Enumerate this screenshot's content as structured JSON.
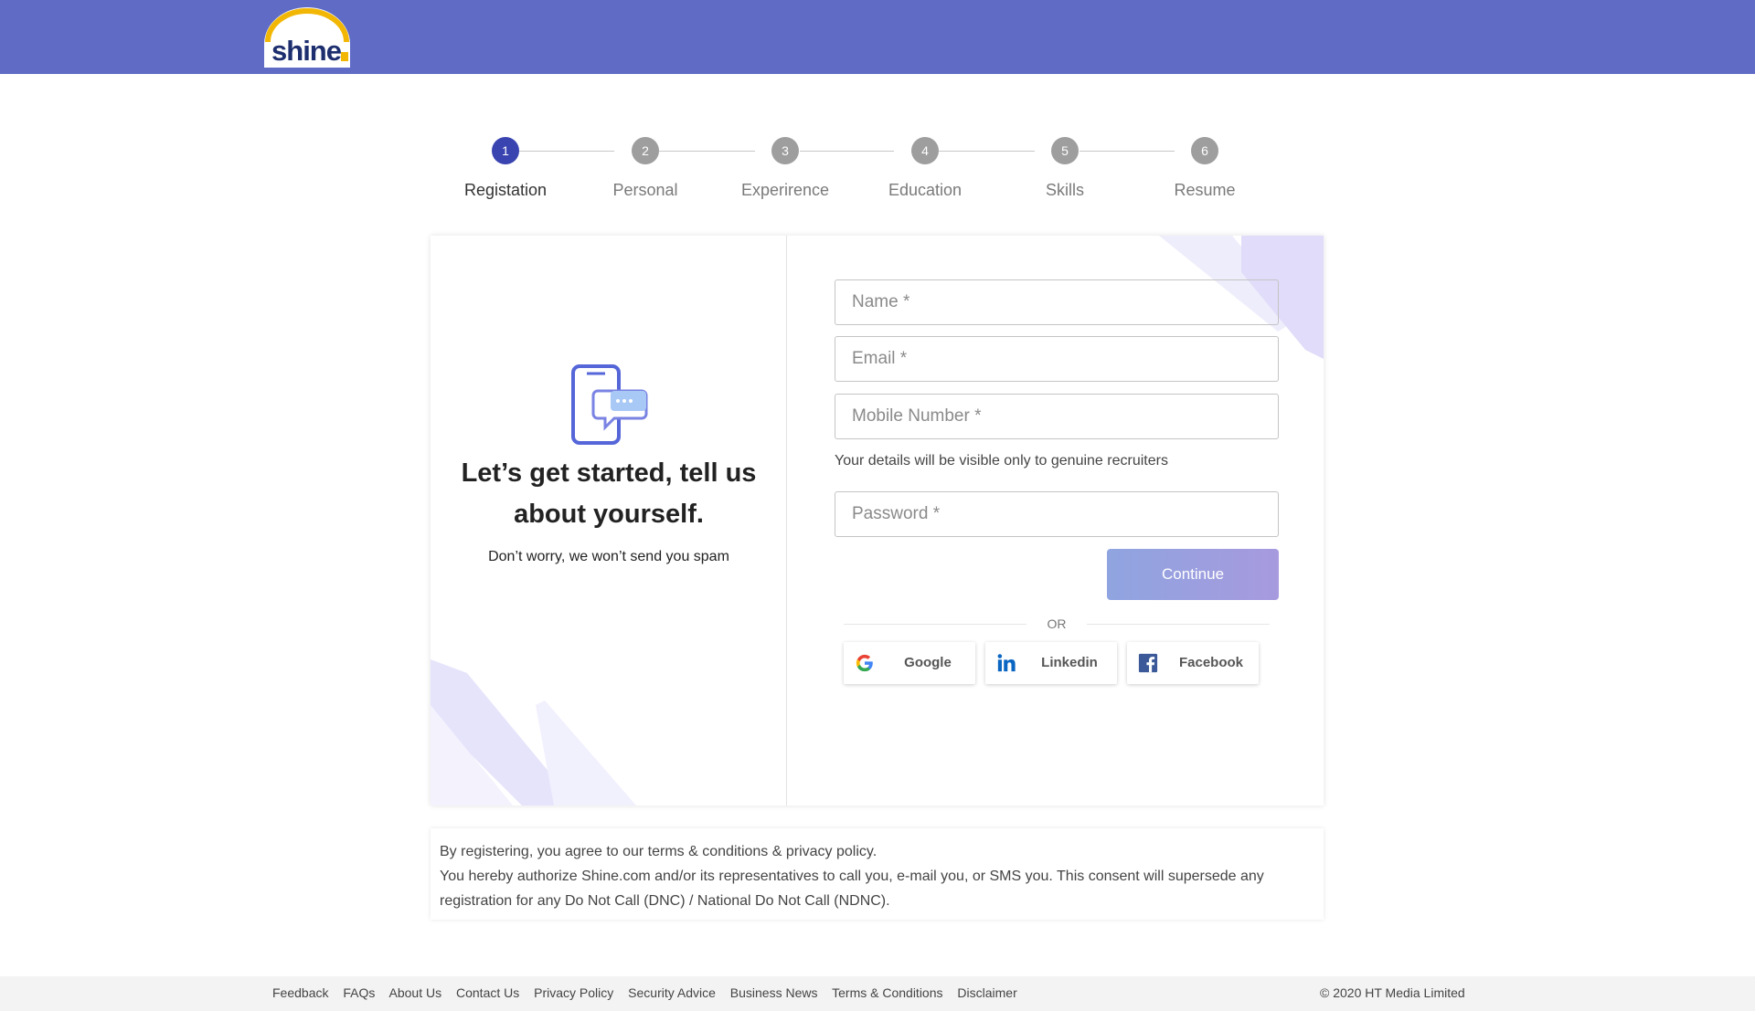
{
  "header": {
    "logo_text": "shine",
    "logo_icon": "shine-logo-icon",
    "brand_color": "#5f6bc4"
  },
  "stepper": {
    "active_index": 0,
    "steps": [
      {
        "number": "1",
        "label": "Registation"
      },
      {
        "number": "2",
        "label": "Personal"
      },
      {
        "number": "3",
        "label": "Experirence"
      },
      {
        "number": "4",
        "label": "Education"
      },
      {
        "number": "5",
        "label": "Skills"
      },
      {
        "number": "6",
        "label": "Resume"
      }
    ]
  },
  "left_panel": {
    "icon": "phone-chat-icon",
    "title": "Let’s get started, tell us about yourself.",
    "subtitle": "Don’t worry, we won’t send you spam"
  },
  "form": {
    "name": {
      "value": "",
      "placeholder": "Name *"
    },
    "email": {
      "value": "",
      "placeholder": "Email *"
    },
    "mobile": {
      "value": "",
      "placeholder": "Mobile Number *"
    },
    "note": "Your details will be visible only to genuine recruiters",
    "password": {
      "value": "",
      "placeholder": "Password *"
    },
    "continue_label": "Continue",
    "or_label": "OR",
    "social": [
      {
        "label": "Google",
        "icon": "google-icon"
      },
      {
        "label": "Linkedin",
        "icon": "linkedin-icon"
      },
      {
        "label": "Facebook",
        "icon": "facebook-icon"
      }
    ]
  },
  "consent": {
    "line1": "By registering, you agree to our terms & conditions & privacy policy.",
    "line2": "You hereby authorize Shine.com and/or its representatives to call you, e-mail you, or SMS you. This consent will supersede any registration for any Do Not Call (DNC) / National Do Not Call (NDNC)."
  },
  "footer": {
    "links": [
      "Feedback",
      "FAQs",
      "About Us",
      "Contact Us",
      "Privacy Policy",
      "Security Advice",
      "Business News",
      "Terms & Conditions",
      "Disclaimer"
    ],
    "copyright": "© 2020 HT Media Limited"
  }
}
